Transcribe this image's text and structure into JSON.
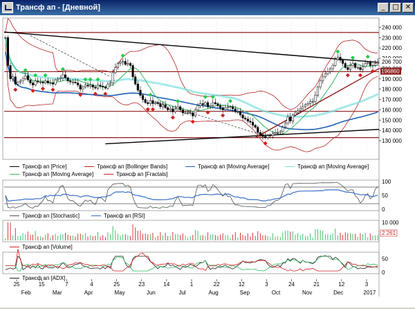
{
  "window": {
    "title": "Трансф ап - [Дневной]",
    "btn_min": "_",
    "btn_max": "□",
    "btn_close": "✕"
  },
  "colors": {
    "price": "#000000",
    "bollinger": "#b22222",
    "ma_long": "#1f5fb4",
    "ma_mid": "#7fe0e0",
    "ma_short": "#2fb860",
    "fractal_up": "#1ecf4a",
    "fractal_down": "#d42020",
    "hline": "#8b1a1a",
    "trend": "#000000",
    "stoch": "#505050",
    "rsi": "#3a6fc7",
    "volume": "#d42020",
    "adx": "#202020"
  },
  "chart_data": [
    {
      "type": "candlestick",
      "name": "price",
      "ylim": [
        120000,
        245000
      ],
      "yticks": [
        "240 000",
        "230 000",
        "220 000",
        "210 000",
        "200 000",
        "190 000",
        "180 000",
        "170 000",
        "160 000",
        "150 000",
        "140 000",
        "130 000"
      ],
      "last_labels": [
        "206 700",
        "196860"
      ],
      "hlines": [
        235000,
        197000,
        158500,
        133000
      ],
      "x_top_ticks": [
        "25",
        "15",
        "7",
        "4",
        "25",
        "23",
        "14",
        "1",
        "22",
        "12",
        "3",
        "24",
        "21",
        "12",
        "3"
      ],
      "x_bottom_ticks": [
        "Feb",
        "Mar",
        "Apr",
        "May",
        "Jun",
        "Jul",
        "Aug",
        "Sep",
        "Oct",
        "Nov",
        "Dec",
        "2017"
      ],
      "legend": [
        "Трансф ап [Price]",
        "Трансф ап [Bollinger Bands]",
        "Трансф ап [Moving Average]",
        "Трансф ап [Moving Average]",
        "Трансф ап [Moving Average]",
        "Трансф ап [Fractals]"
      ],
      "close": [
        230000,
        203000,
        190000,
        192000,
        185000,
        187000,
        188000,
        190000,
        193000,
        189000,
        186000,
        184000,
        188000,
        187000,
        187000,
        186000,
        188000,
        186000,
        186000,
        185000,
        189000,
        190000,
        191000,
        194000,
        191000,
        188000,
        187000,
        187000,
        186000,
        184000,
        180000,
        182000,
        184000,
        183000,
        184000,
        182000,
        181000,
        184000,
        183000,
        182000,
        181000,
        185000,
        186000,
        196000,
        201000,
        205000,
        206000,
        207000,
        204000,
        205000,
        203000,
        192000,
        185000,
        179000,
        174000,
        170000,
        167000,
        166000,
        169000,
        166000,
        167000,
        166000,
        163000,
        165000,
        162000,
        160000,
        161000,
        158000,
        161000,
        163000,
        160000,
        157000,
        157000,
        157000,
        157000,
        154000,
        160000,
        164000,
        166000,
        165000,
        167000,
        163000,
        164000,
        167000,
        166000,
        164000,
        162000,
        160000,
        162000,
        163000,
        163000,
        161000,
        158000,
        158000,
        155000,
        152000,
        151000,
        149000,
        148000,
        145000,
        143000,
        138000,
        136000,
        134000,
        133000,
        135000,
        135000,
        137000,
        138000,
        138000,
        139000,
        143000,
        147000,
        153000,
        149000,
        155000,
        157000,
        159000,
        161000,
        163000,
        165000,
        166000,
        168000,
        168000,
        174000,
        182000,
        188000,
        192000,
        195000,
        197000,
        200000,
        203000,
        209000,
        211000,
        208000,
        205000,
        201000,
        199000,
        203000,
        205000,
        201000,
        201000,
        199000,
        202000,
        205000,
        206000,
        203000,
        203000,
        205000,
        206000
      ]
    },
    {
      "type": "line",
      "name": "oscillators",
      "ylim": [
        0,
        100
      ],
      "yticks": [
        "100",
        "50",
        "0"
      ],
      "legend": [
        "Трансф ап [Stochastic]",
        "Трансф ап [RSI]"
      ]
    },
    {
      "type": "bar",
      "name": "volume",
      "yticks": [
        "10 000"
      ],
      "last_label": "2 261",
      "legend": [
        "Трансф ап [Volume]"
      ]
    },
    {
      "type": "line",
      "name": "adx",
      "ylim": [
        0,
        70
      ],
      "yticks": [
        "50",
        "0"
      ],
      "legend": [
        "Трансф ап [ADX]"
      ]
    }
  ]
}
